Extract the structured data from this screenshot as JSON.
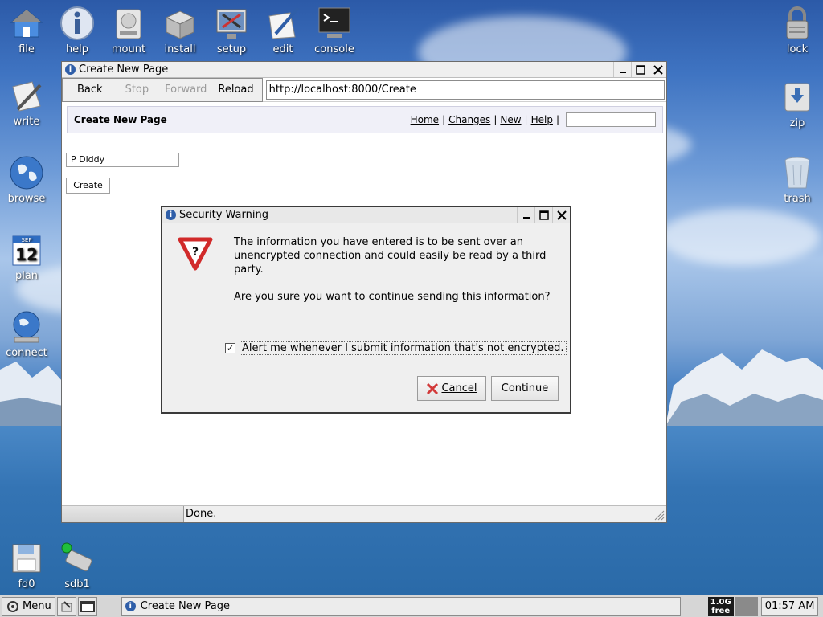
{
  "desktop": {
    "icons": [
      {
        "label": "file",
        "icon": "home-folder-icon"
      },
      {
        "label": "help",
        "icon": "info-icon"
      },
      {
        "label": "mount",
        "icon": "drive-icon"
      },
      {
        "label": "install",
        "icon": "package-icon"
      },
      {
        "label": "setup",
        "icon": "tools-icon"
      },
      {
        "label": "edit",
        "icon": "pen-paper-icon"
      },
      {
        "label": "console",
        "icon": "terminal-icon"
      },
      {
        "label": "lock",
        "icon": "padlock-icon"
      },
      {
        "label": "write",
        "icon": "document-pen-icon"
      },
      {
        "label": "zip",
        "icon": "archive-icon"
      },
      {
        "label": "browse",
        "icon": "globe-icon"
      },
      {
        "label": "trash",
        "icon": "trash-icon"
      },
      {
        "label": "plan",
        "icon": "calendar-icon"
      },
      {
        "label": "connect",
        "icon": "network-globe-icon"
      },
      {
        "label": "fd0",
        "icon": "floppy-icon"
      },
      {
        "label": "sdb1",
        "icon": "usb-drive-icon"
      }
    ],
    "calendar_month": "SEP",
    "calendar_day": "12"
  },
  "browser": {
    "title": "Create New Page",
    "nav": {
      "back": "Back",
      "stop": "Stop",
      "forward": "Forward",
      "reload": "Reload"
    },
    "url": "http://localhost:8000/Create",
    "page": {
      "heading": "Create New Page",
      "links": [
        "Home",
        "Changes",
        "New",
        "Help"
      ],
      "search_value": "",
      "name_value": "P Diddy",
      "create_button": "Create"
    },
    "status": "Done."
  },
  "dialog": {
    "title": "Security Warning",
    "message1": "The information you have entered is to be sent over an unencrypted connection and could easily be read by a third party.",
    "message2": "Are you sure you want to continue sending this information?",
    "checkbox_label": "Alert me whenever I submit information that's not encrypted.",
    "checkbox_checked": true,
    "cancel_label": "Cancel",
    "continue_label": "Continue"
  },
  "taskbar": {
    "menu_label": "Menu",
    "task_label": "Create New Page",
    "free_line1": "1.0G",
    "free_line2": "free",
    "clock": "01:57 AM"
  }
}
